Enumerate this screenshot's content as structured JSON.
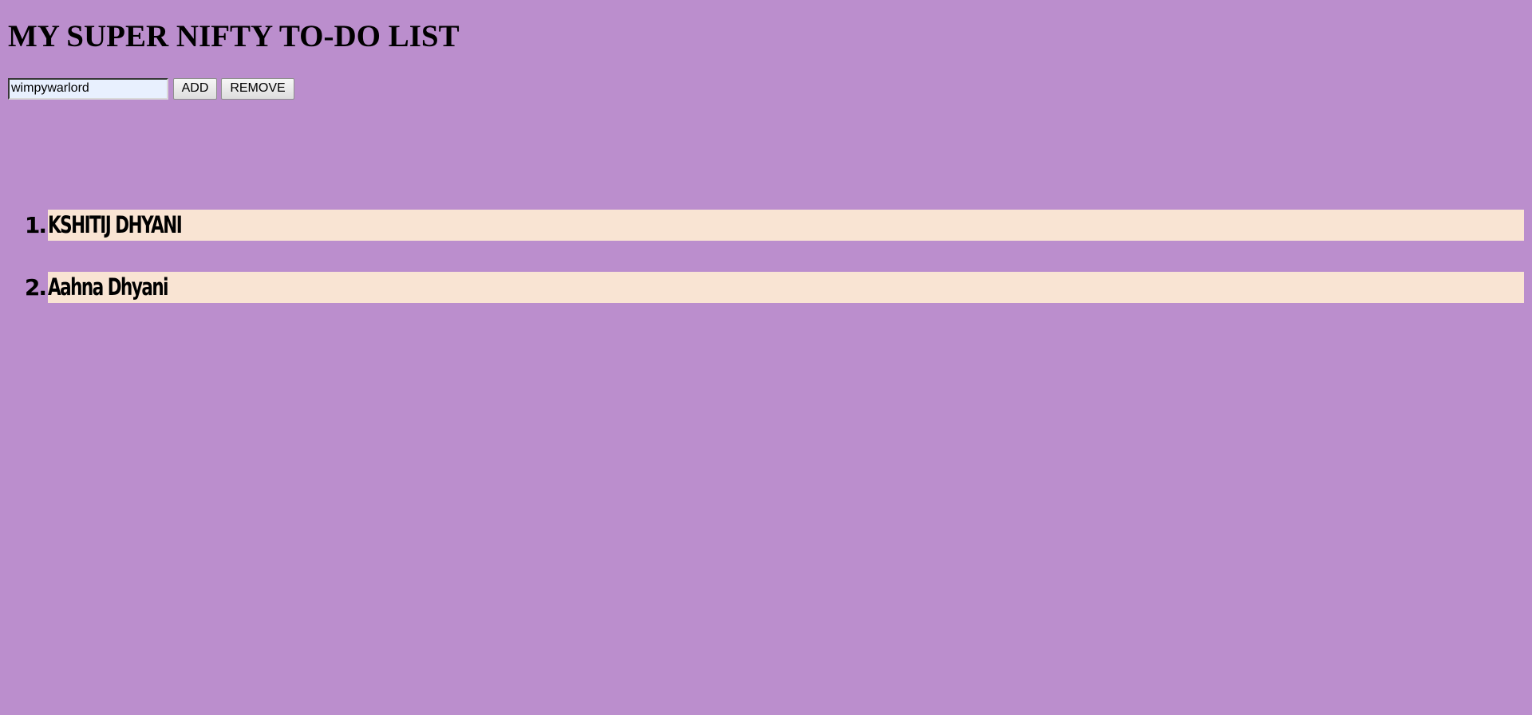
{
  "page": {
    "title": "MY SUPER NIFTY TO-DO LIST",
    "background_color": "#bb8ecd"
  },
  "controls": {
    "input_value": "wimpywarlord",
    "add_label": "ADD",
    "remove_label": "REMOVE"
  },
  "todos": {
    "item_background": "#f9e4d3",
    "items": [
      {
        "number": "1.",
        "text": "KSHITIJ DHYANI"
      },
      {
        "number": "2.",
        "text": "Aahna Dhyani"
      }
    ]
  }
}
